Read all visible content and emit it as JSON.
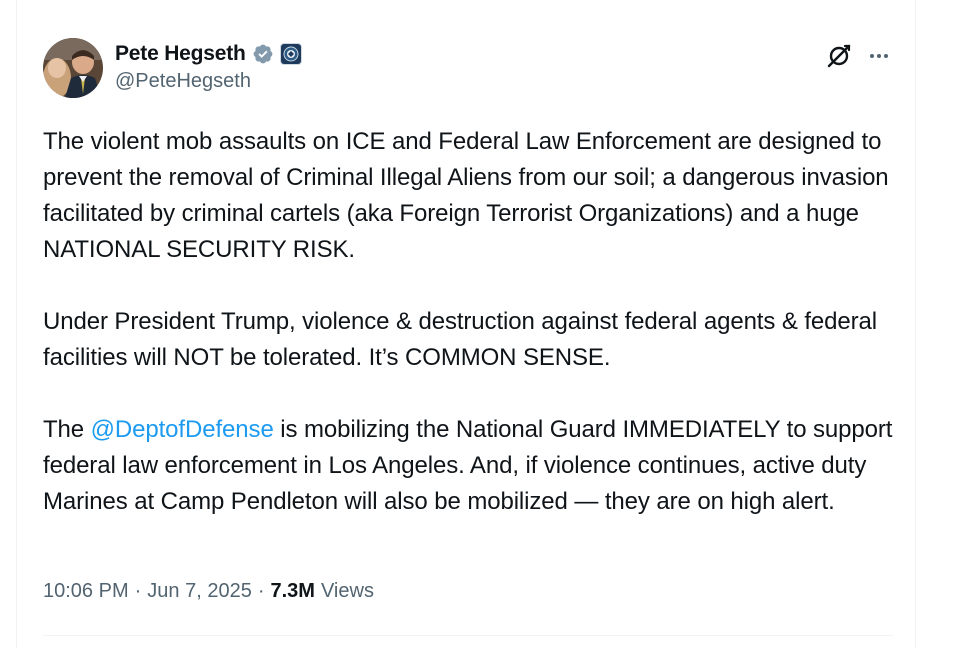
{
  "author": {
    "display_name": "Pete Hegseth",
    "handle": "@PeteHegseth"
  },
  "tweet": {
    "paragraphs": [
      {
        "text": "The violent mob assaults on ICE and Federal Law Enforcement are designed to prevent the removal of Criminal Illegal Aliens from our soil; a dangerous invasion facilitated by criminal cartels (aka Foreign Terrorist Organizations) and a huge NATIONAL SECURITY RISK."
      },
      {
        "text": "Under President Trump, violence & destruction against federal agents & federal facilities will NOT be tolerated. It’s COMMON SENSE."
      },
      {
        "prefix": "The ",
        "mention": "@DeptofDefense",
        "suffix": " is mobilizing the National Guard IMMEDIATELY to support federal law enforcement in Los Angeles. And, if violence continues, active duty Marines at Camp Pendleton will also be mobilized — they are on high alert."
      }
    ]
  },
  "meta": {
    "time": "10:06 PM",
    "separator": "·",
    "date": "Jun 7, 2025",
    "views_count": "7.3M",
    "views_label": "Views"
  },
  "icons": {
    "verified": "verified-badge-icon",
    "affiliation": "department-of-defense-seal-icon",
    "grok": "grok-icon",
    "more": "more-options-icon"
  },
  "colors": {
    "text": "#0f1419",
    "secondary": "#536471",
    "link": "#1d9bf0",
    "verified_badge": "#829aab"
  }
}
